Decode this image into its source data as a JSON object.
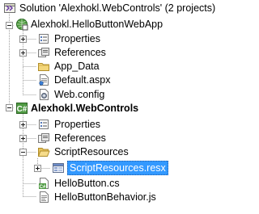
{
  "solution_explorer": {
    "solution": {
      "label": "Solution 'Alexhokl.WebControls' (2 projects)"
    },
    "projects": [
      {
        "label": "Alexhokl.HelloButtonWebApp",
        "items": [
          {
            "label": "Properties",
            "icon": "properties-icon"
          },
          {
            "label": "References",
            "icon": "references-icon"
          },
          {
            "label": "App_Data",
            "icon": "folder-icon"
          },
          {
            "label": "Default.aspx",
            "icon": "aspx-page-icon"
          },
          {
            "label": "Web.config",
            "icon": "config-icon"
          }
        ]
      },
      {
        "label": "Alexhokl.WebControls",
        "items": [
          {
            "label": "Properties",
            "icon": "properties-icon"
          },
          {
            "label": "References",
            "icon": "references-icon"
          },
          {
            "label": "ScriptResources",
            "icon": "folder-open-icon"
          },
          {
            "label": "ScriptResources.resx",
            "icon": "resx-icon",
            "selected": true
          },
          {
            "label": "HelloButton.cs",
            "icon": "csharp-file-icon"
          },
          {
            "label": "HelloButtonBehavior.js",
            "icon": "js-file-icon"
          }
        ]
      }
    ]
  },
  "colors": {
    "selection": "#3399ff",
    "selection_text": "#ffffff",
    "guide_line": "#a0a0a0"
  }
}
